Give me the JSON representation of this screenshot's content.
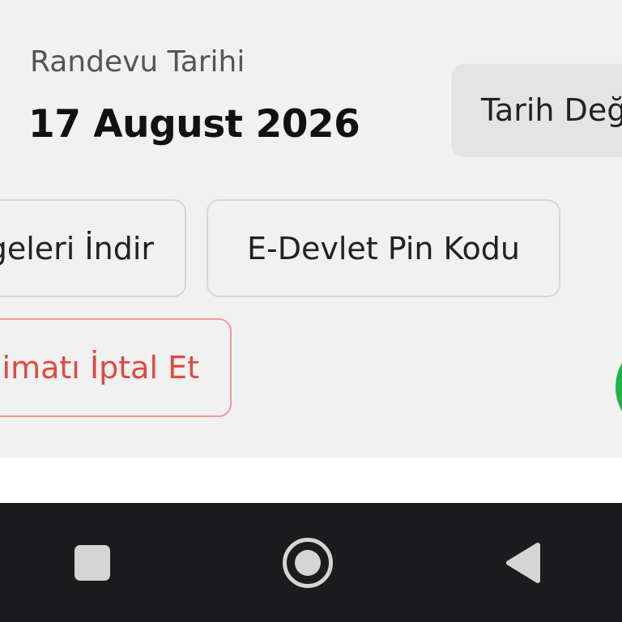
{
  "appointment": {
    "date_label": "Randevu Tarihi",
    "date_value": "17 August 2026",
    "change_date_label": "Tarih Değiştir"
  },
  "actions": {
    "download_label": "Belgeleri İndir",
    "pin_label": "E-Devlet Pin Kodu",
    "cancel_label": "Randevu Talimatı İptal Et"
  },
  "colors": {
    "cancel_accent": "#de4a3f",
    "cancel_border": "#ef9c95",
    "green_accent": "#22b24c",
    "nav_background": "#1c1b1d"
  },
  "nav": {
    "recents_icon": "square-icon",
    "home_icon": "circle-home-icon",
    "back_icon": "triangle-back-icon"
  }
}
